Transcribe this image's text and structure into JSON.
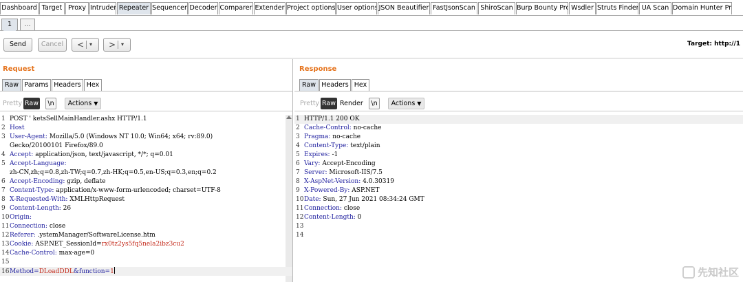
{
  "main_tabs": [
    "Dashboard",
    "Target",
    "Proxy",
    "Intruder",
    "Repeater",
    "Sequencer",
    "Decoder",
    "Comparer",
    "Extender",
    "Project options",
    "User options",
    "JSON Beautifier",
    "FastJsonScan",
    "ShiroScan",
    "Burp Bounty Pro",
    "Wsdler",
    "Struts Finder",
    "UA Scan",
    "Domain Hunter Pro"
  ],
  "active_main_tab": "Repeater",
  "sub_tabs": {
    "active": "1",
    "more": "..."
  },
  "toolbar": {
    "send": "Send",
    "cancel": "Cancel",
    "back_symbol": "<",
    "forward_symbol": ">",
    "caret": "▾",
    "target": "Target: http://1"
  },
  "request": {
    "title": "Request",
    "tabs": [
      "Raw",
      "Params",
      "Headers",
      "Hex"
    ],
    "active_tab": "Raw",
    "view_buttons": {
      "pretty": "Pretty",
      "raw": "Raw",
      "newline": "\\n",
      "actions": "Actions"
    },
    "lines": [
      {
        "n": "1",
        "key": "",
        "val": "POST '                    ketsSellMainHandler.ashx HTTP/1.1"
      },
      {
        "n": "2",
        "key": "Host",
        "val": ""
      },
      {
        "n": "3",
        "key": "User-Agent:",
        "val": " Mozilla/5.0 (Windows NT 10.0; Win64; x64; rv:89.0)"
      },
      {
        "n": "",
        "key": "",
        "val": "Gecko/20100101 Firefox/89.0"
      },
      {
        "n": "4",
        "key": "Accept:",
        "val": " application/json, text/javascript, */*; q=0.01"
      },
      {
        "n": "5",
        "key": "Accept-Language:",
        "val": ""
      },
      {
        "n": "",
        "key": "",
        "val": "zh-CN,zh;q=0.8,zh-TW;q=0.7,zh-HK;q=0.5,en-US;q=0.3,en;q=0.2"
      },
      {
        "n": "6",
        "key": "Accept-Encoding:",
        "val": " gzip, deflate"
      },
      {
        "n": "7",
        "key": "Content-Type:",
        "val": " application/x-www-form-urlencoded; charset=UTF-8"
      },
      {
        "n": "8",
        "key": "X-Requested-With:",
        "val": " XMLHttpRequest"
      },
      {
        "n": "9",
        "key": "Content-Length:",
        "val": " 26"
      },
      {
        "n": "10",
        "key": "Origin:",
        "val": ""
      },
      {
        "n": "11",
        "key": "Connection:",
        "val": " close"
      },
      {
        "n": "12",
        "key": "Referer:",
        "val": "                              .ystemManager/SoftwareLicense.htm"
      },
      {
        "n": "13",
        "key": "Cookie:",
        "val": " ASP.NET_SessionId=",
        "red": "rx0tz2ys5fq5nela2ibz3cu2"
      },
      {
        "n": "14",
        "key": "Cache-Control:",
        "val": " max-age=0"
      },
      {
        "n": "15",
        "key": "",
        "val": ""
      },
      {
        "n": "16",
        "key": "Method=",
        "val": "",
        "red": "DLoadDDL",
        "key2": "&function=",
        "red2": "1"
      }
    ]
  },
  "response": {
    "title": "Response",
    "tabs": [
      "Raw",
      "Headers",
      "Hex"
    ],
    "active_tab": "Raw",
    "view_buttons": {
      "pretty": "Pretty",
      "raw": "Raw",
      "render": "Render",
      "newline": "\\n",
      "actions": "Actions"
    },
    "lines": [
      {
        "n": "1",
        "key": "",
        "val": "HTTP/1.1 200 OK"
      },
      {
        "n": "2",
        "key": "Cache-Control:",
        "val": " no-cache"
      },
      {
        "n": "3",
        "key": "Pragma:",
        "val": " no-cache"
      },
      {
        "n": "4",
        "key": "Content-Type:",
        "val": " text/plain"
      },
      {
        "n": "5",
        "key": "Expires:",
        "val": " -1"
      },
      {
        "n": "6",
        "key": "Vary:",
        "val": " Accept-Encoding"
      },
      {
        "n": "7",
        "key": "Server:",
        "val": " Microsoft-IIS/7.5"
      },
      {
        "n": "8",
        "key": "X-AspNet-Version:",
        "val": " 4.0.30319"
      },
      {
        "n": "9",
        "key": "X-Powered-By:",
        "val": " ASP.NET"
      },
      {
        "n": "10",
        "key": "Date:",
        "val": " Sun, 27 Jun 2021 08:34:24 GMT"
      },
      {
        "n": "11",
        "key": "Connection:",
        "val": " close"
      },
      {
        "n": "12",
        "key": "Content-Length:",
        "val": " 0"
      },
      {
        "n": "13",
        "key": "",
        "val": ""
      },
      {
        "n": "14",
        "key": "",
        "val": ""
      }
    ]
  },
  "watermark": "先知社区"
}
